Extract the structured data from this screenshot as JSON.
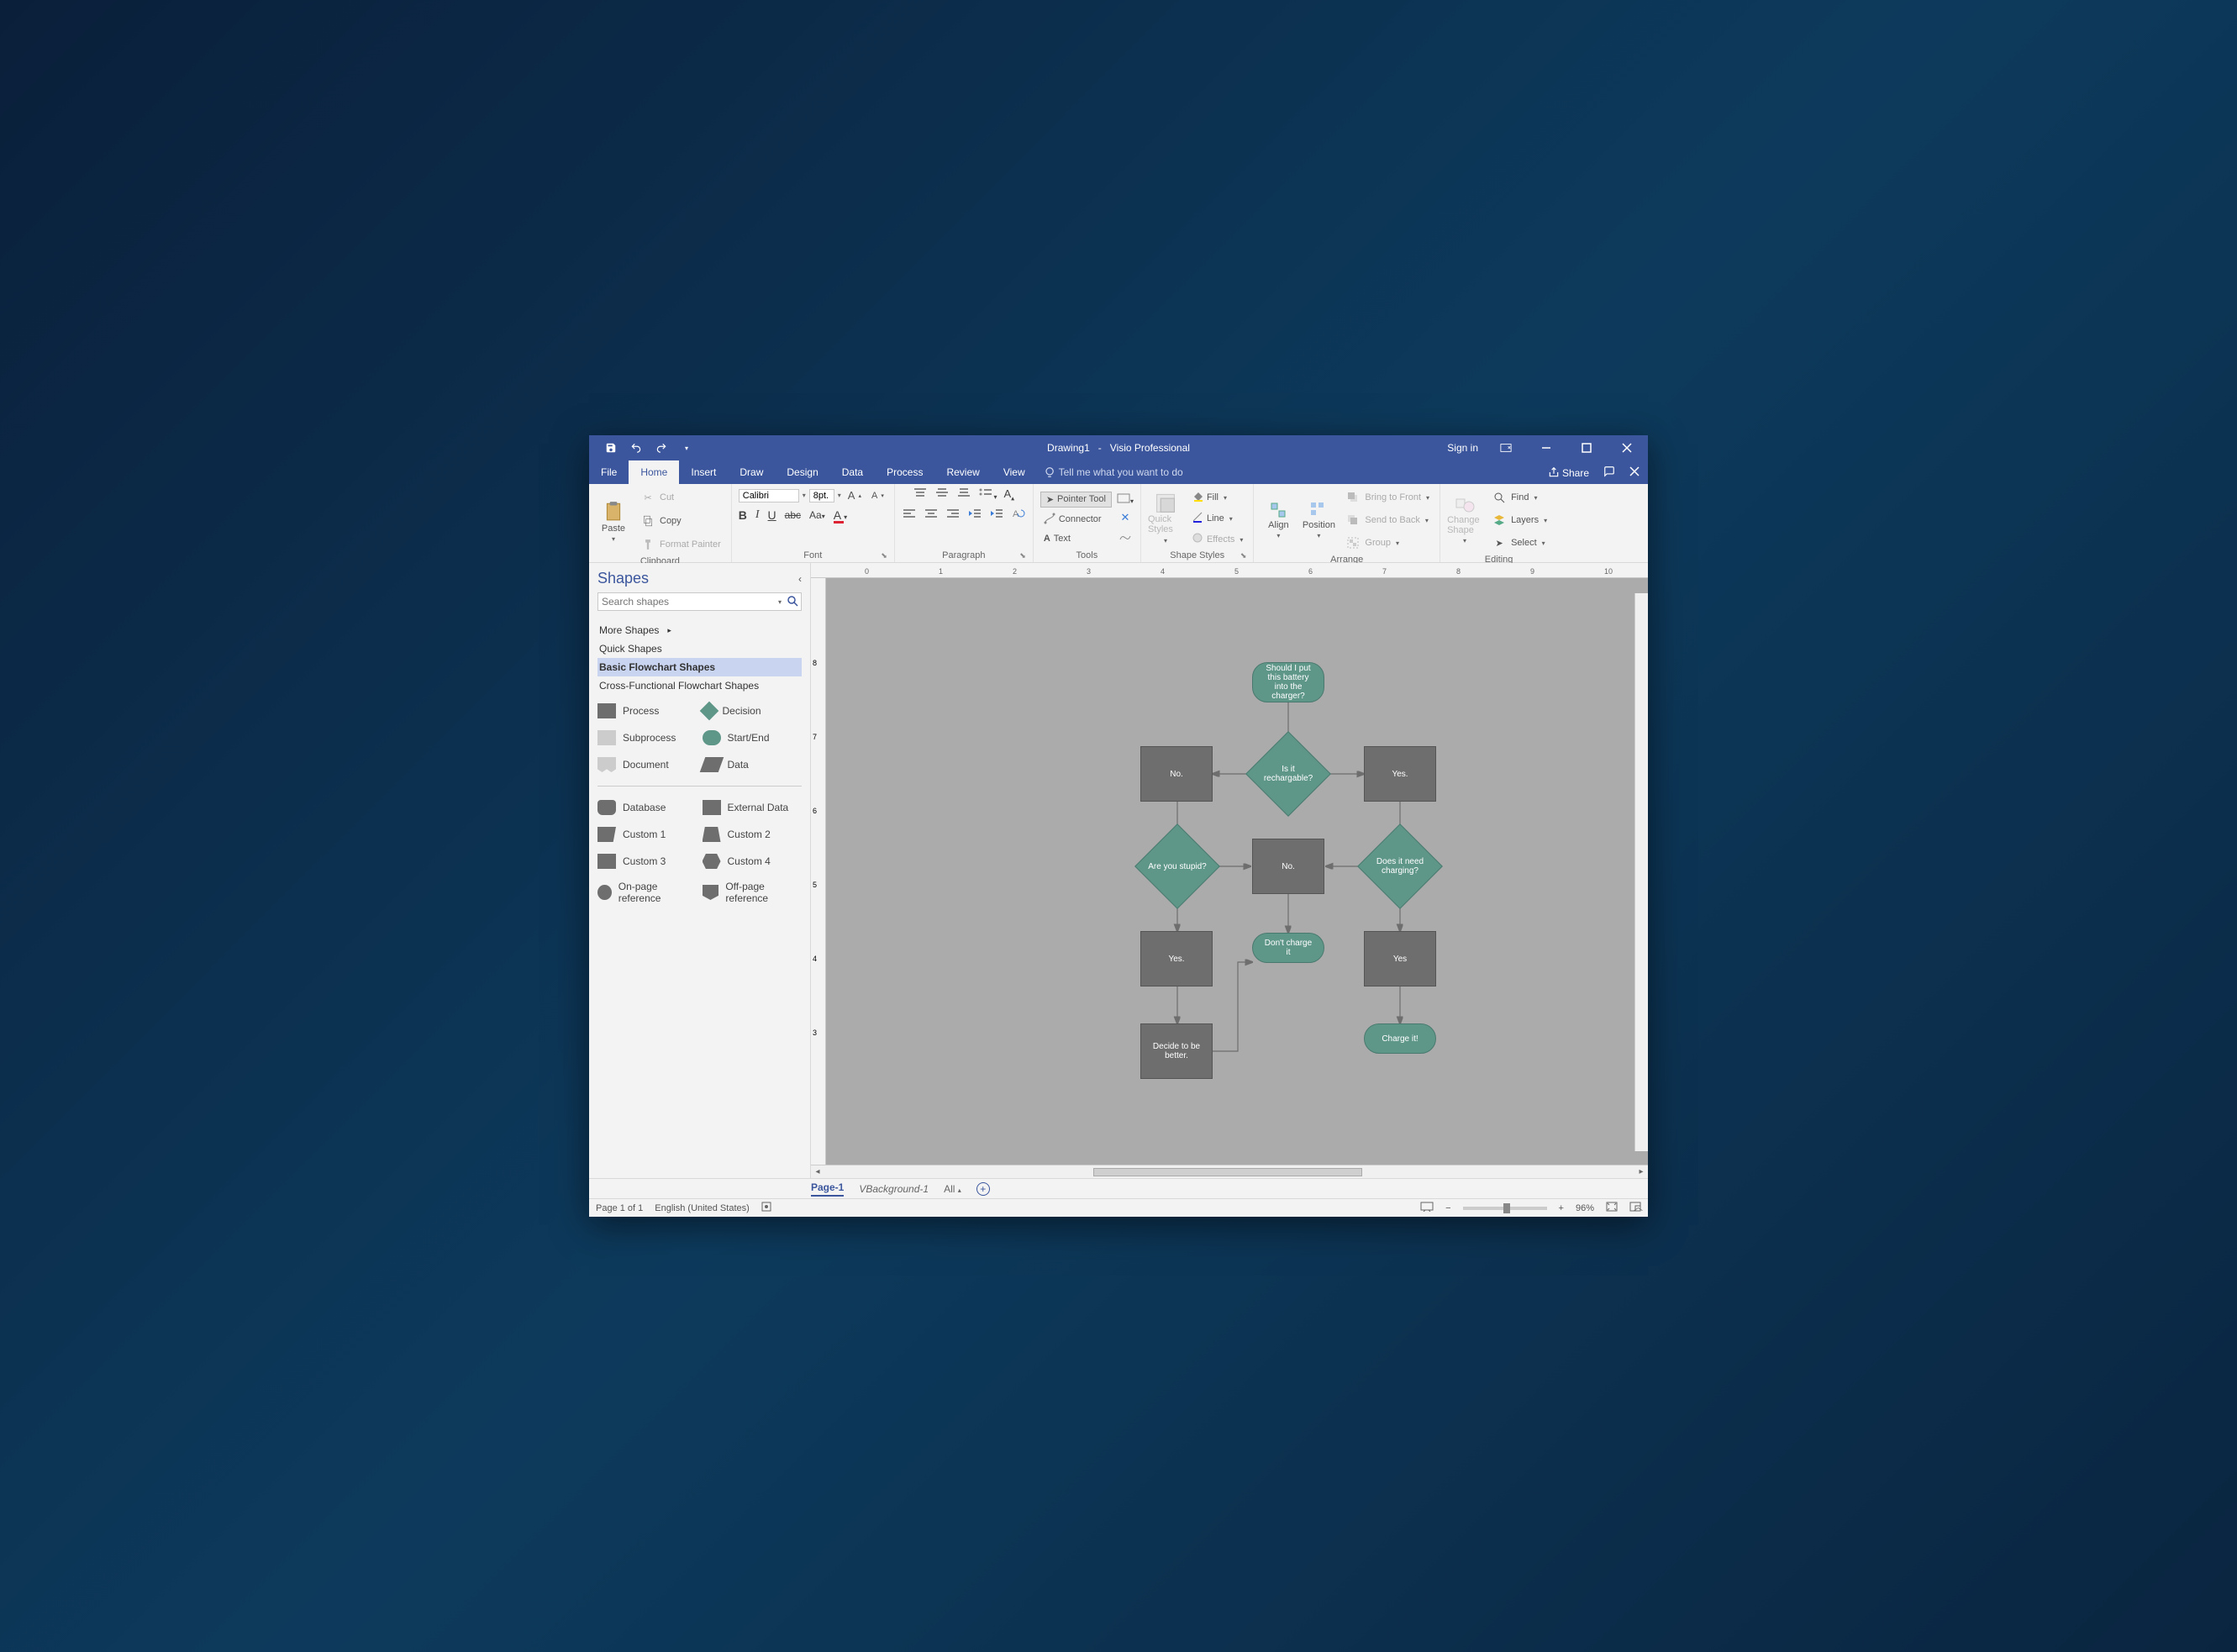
{
  "titlebar": {
    "doc_name": "Drawing1",
    "app_name": "Visio Professional",
    "signin": "Sign in"
  },
  "menubar": {
    "tabs": [
      "File",
      "Home",
      "Insert",
      "Draw",
      "Design",
      "Data",
      "Process",
      "Review",
      "View"
    ],
    "active_index": 1,
    "tell_me": "Tell me what you want to do",
    "share": "Share"
  },
  "ribbon": {
    "clipboard": {
      "paste": "Paste",
      "cut": "Cut",
      "copy": "Copy",
      "format_painter": "Format Painter",
      "label": "Clipboard"
    },
    "font": {
      "name": "Calibri",
      "size": "8pt.",
      "label": "Font"
    },
    "paragraph": {
      "label": "Paragraph"
    },
    "tools": {
      "pointer": "Pointer Tool",
      "connector": "Connector",
      "text": "Text",
      "label": "Tools"
    },
    "shape_styles": {
      "quick_styles": "Quick Styles",
      "fill": "Fill",
      "line": "Line",
      "effects": "Effects",
      "label": "Shape Styles"
    },
    "arrange": {
      "align": "Align",
      "position": "Position",
      "bring_front": "Bring to Front",
      "send_back": "Send to Back",
      "group": "Group",
      "label": "Arrange"
    },
    "editing": {
      "change_shape": "Change Shape",
      "find": "Find",
      "layers": "Layers",
      "select": "Select",
      "label": "Editing"
    }
  },
  "shapes_pane": {
    "title": "Shapes",
    "search_placeholder": "Search shapes",
    "more_shapes": "More Shapes",
    "categories": [
      {
        "label": "Quick Shapes",
        "selected": false
      },
      {
        "label": "Basic Flowchart Shapes",
        "selected": true
      },
      {
        "label": "Cross-Functional Flowchart Shapes",
        "selected": false
      }
    ],
    "stencil": {
      "process": "Process",
      "decision": "Decision",
      "subprocess": "Subprocess",
      "startend": "Start/End",
      "document": "Document",
      "data": "Data",
      "database": "Database",
      "external_data": "External Data",
      "custom1": "Custom 1",
      "custom2": "Custom 2",
      "custom3": "Custom 3",
      "custom4": "Custom 4",
      "onpage": "On-page reference",
      "offpage": "Off-page reference"
    }
  },
  "flowchart": {
    "start": "Should I put this battery into the charger?",
    "decision_recharge": "Is it rechargable?",
    "no1": "No.",
    "yes1": "Yes.",
    "decision_stupid": "Are you stupid?",
    "no2": "No.",
    "decision_need": "Does it need charging?",
    "yes_bottom": "Yes.",
    "dont_charge": "Don't charge it",
    "yes_right": "Yes",
    "decide_better": "Decide to be better.",
    "charge_it": "Charge it!"
  },
  "pagetabs": {
    "page1": "Page-1",
    "vbg": "VBackground-1",
    "all": "All"
  },
  "statusbar": {
    "page_info": "Page 1 of 1",
    "language": "English (United States)",
    "zoom": "96%"
  },
  "ruler_h": [
    "0",
    "1",
    "2",
    "3",
    "4",
    "5",
    "6",
    "7",
    "8",
    "9",
    "10"
  ],
  "ruler_v": [
    "8",
    "7",
    "6",
    "5",
    "4",
    "3"
  ]
}
